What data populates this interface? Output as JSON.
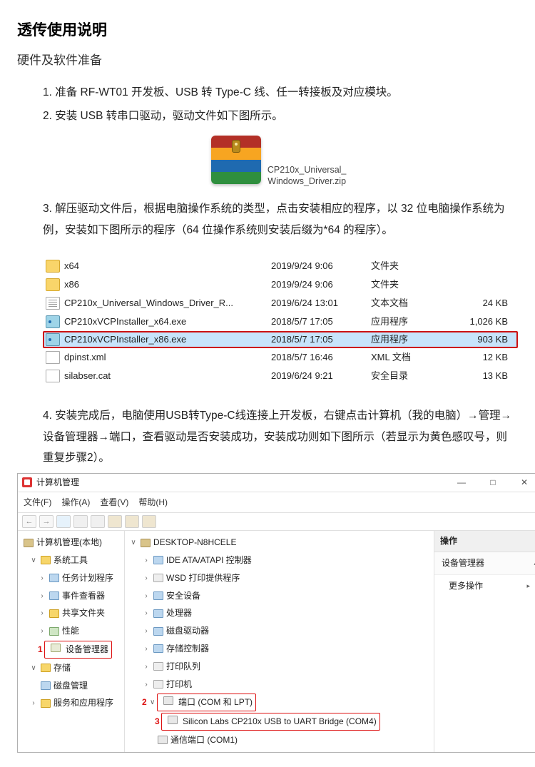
{
  "doc": {
    "title": "透传使用说明",
    "subtitle": "硬件及软件准备",
    "step1": "1. 准备 RF-WT01 开发板、USB 转 Type-C 线、任一转接板及对应模块。",
    "step2": "2. 安装 USB 转串口驱动，驱动文件如下图所示。",
    "zip_caption": "CP210x_Universal_Windows_Driver.zip",
    "step3": "3. 解压驱动文件后，根据电脑操作系统的类型，点击安装相应的程序，以 32 位电脑操作系统为例，安装如下图所示的程序（64 位操作系统则安装后缀为*64 的程序）。",
    "step4": "4. 安装完成后，电脑使用USB转Type-C线连接上开发板，右键点击计算机（我的电脑）→管理→设备管理器→端口，查看驱动是否安装成功，安装成功则如下图所示（若显示为黄色感叹号，则重复步骤2）。"
  },
  "filelist": [
    {
      "icon": "folder",
      "name": "x64",
      "date": "2019/9/24 9:06",
      "type": "文件夹",
      "size": ""
    },
    {
      "icon": "folder",
      "name": "x86",
      "date": "2019/9/24 9:06",
      "type": "文件夹",
      "size": ""
    },
    {
      "icon": "txtfile",
      "name": "CP210x_Universal_Windows_Driver_R...",
      "date": "2019/6/24 13:01",
      "type": "文本文档",
      "size": "24 KB"
    },
    {
      "icon": "exe",
      "name": "CP210xVCPInstaller_x64.exe",
      "date": "2018/5/7 17:05",
      "type": "应用程序",
      "size": "1,026 KB"
    },
    {
      "icon": "exe",
      "name": "CP210xVCPInstaller_x86.exe",
      "date": "2018/5/7 17:05",
      "type": "应用程序",
      "size": "903 KB",
      "selected": true,
      "boxed": true
    },
    {
      "icon": "xml",
      "name": "dpinst.xml",
      "date": "2018/5/7 16:46",
      "type": "XML 文档",
      "size": "12 KB"
    },
    {
      "icon": "cat",
      "name": "silabser.cat",
      "date": "2019/6/24 9:21",
      "type": "安全目录",
      "size": "13 KB"
    }
  ],
  "mgmt": {
    "window_title": "计算机管理",
    "menu": {
      "file": "文件(F)",
      "action": "操作(A)",
      "view": "查看(V)",
      "help": "帮助(H)"
    },
    "winbtns": {
      "min": "—",
      "max": "□",
      "close": "✕"
    },
    "left": {
      "root": "计算机管理(本地)",
      "systools": "系统工具",
      "task": "任务计划程序",
      "event": "事件查看器",
      "shared": "共享文件夹",
      "perf": "性能",
      "devmgr": "设备管理器",
      "storage": "存储",
      "diskmgmt": "磁盘管理",
      "services": "服务和应用程序"
    },
    "mid": {
      "pc": "DESKTOP-N8HCELE",
      "ide": "IDE ATA/ATAPI 控制器",
      "wsd": "WSD 打印提供程序",
      "safedev": "安全设备",
      "cpu": "处理器",
      "diskdrv": "磁盘驱动器",
      "storectrl": "存储控制器",
      "printqueue": "打印队列",
      "printer": "打印机",
      "ports": "端口 (COM 和 LPT)",
      "silabs": "Silicon Labs CP210x USB to UART Bridge (COM4)",
      "com1": "通信端口 (COM1)"
    },
    "right": {
      "hdr": "操作",
      "sub": "设备管理器",
      "more": "更多操作"
    },
    "markers": {
      "n1": "1",
      "n2": "2",
      "n3": "3"
    }
  }
}
